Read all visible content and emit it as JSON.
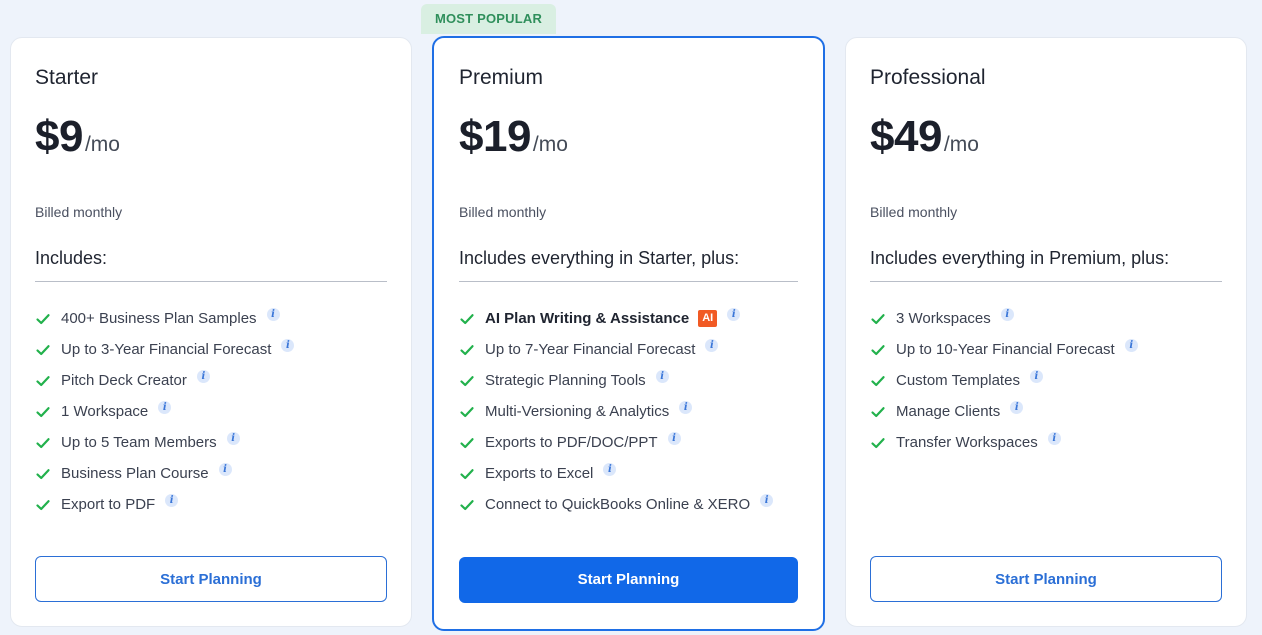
{
  "badge": "MOST POPULAR",
  "colors": {
    "accent": "#1168e8",
    "check": "#22b14c",
    "badge_bg": "#d9efe2",
    "ai_tag": "#f15a24"
  },
  "plans": [
    {
      "name": "Starter",
      "price": "$9",
      "per": "/mo",
      "billing": "Billed monthly",
      "includes": "Includes:",
      "features": [
        "400+ Business Plan Samples",
        "Up to 3-Year Financial Forecast",
        "Pitch Deck Creator",
        "1 Workspace",
        "Up to 5 Team Members",
        "Business Plan Course",
        "Export to PDF"
      ],
      "cta": "Start Planning"
    },
    {
      "name": "Premium",
      "price": "$19",
      "per": "/mo",
      "billing": "Billed monthly",
      "includes": "Includes everything in Starter, plus:",
      "features": [
        "AI Plan Writing & Assistance",
        "Up to 7-Year Financial Forecast",
        "Strategic Planning Tools",
        "Multi-Versioning & Analytics",
        "Exports to PDF/DOC/PPT",
        "Exports to Excel",
        "Connect to QuickBooks Online & XERO"
      ],
      "ai_tag": "AI",
      "cta": "Start Planning"
    },
    {
      "name": "Professional",
      "price": "$49",
      "per": "/mo",
      "billing": "Billed monthly",
      "includes": "Includes everything in Premium, plus:",
      "features": [
        "3 Workspaces",
        "Up to 10-Year Financial Forecast",
        "Custom Templates",
        "Manage Clients",
        "Transfer Workspaces"
      ],
      "cta": "Start Planning"
    }
  ]
}
